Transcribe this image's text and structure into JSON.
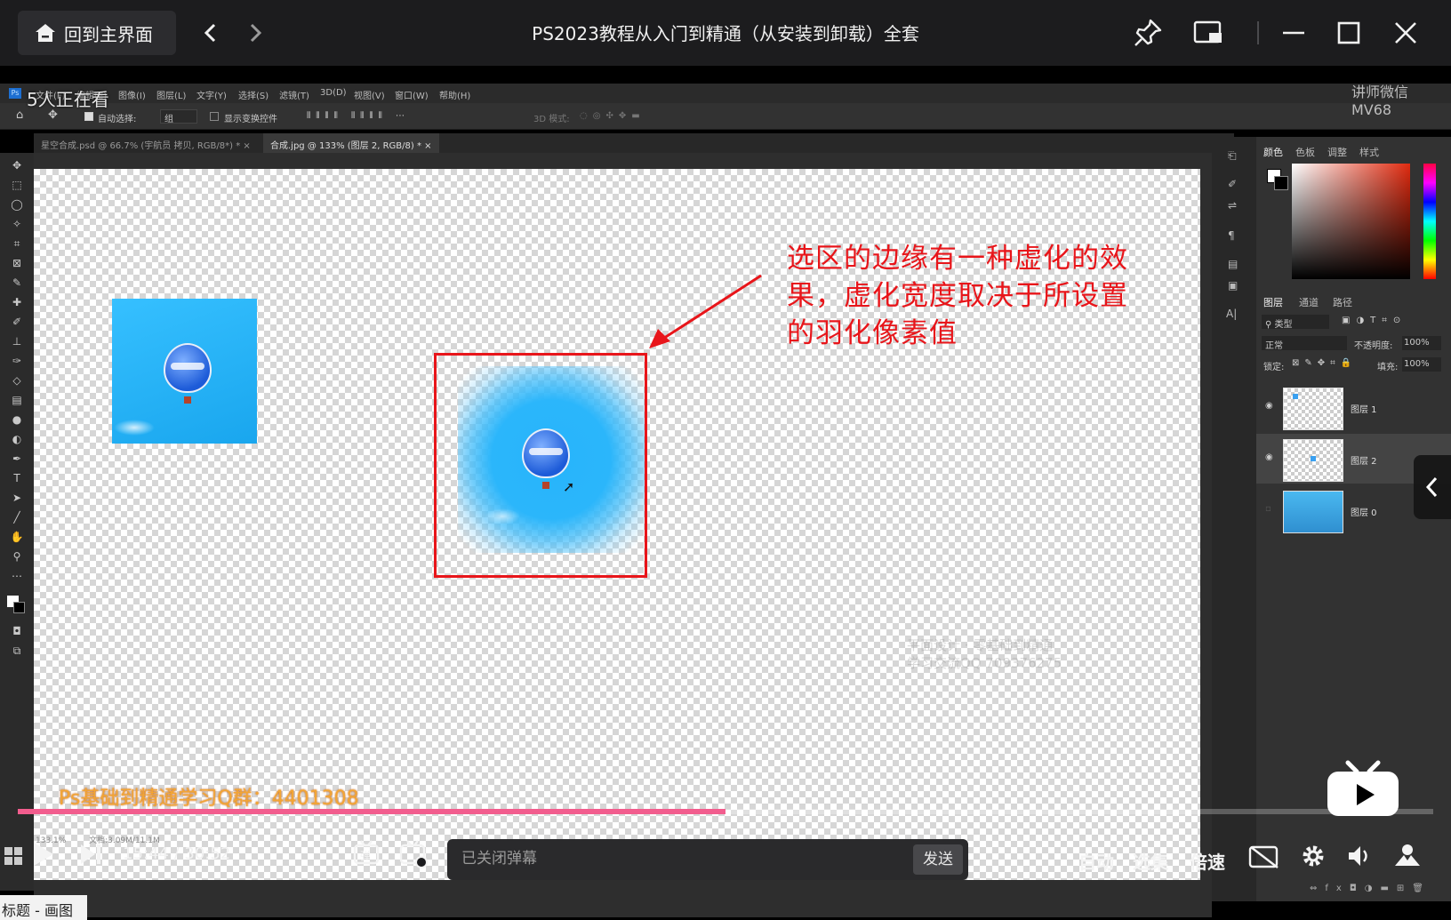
{
  "titlebar": {
    "home_label": "回到主界面",
    "title": "PS2023教程从入门到精通（从安装到卸载）全套"
  },
  "overlay": {
    "viewers": "5人正在看",
    "teacher_line1": "讲师微信",
    "teacher_line2": "MV68",
    "qq_group": "Ps基础到精通学习Q群：4401308",
    "watermark_line1": "平面设计 · 零基础到精通",
    "watermark_line2": "学习交流QQ 709376275"
  },
  "photoshop": {
    "menu": [
      "文件(F)",
      "编辑(E)",
      "图像(I)",
      "图层(L)",
      "文字(Y)",
      "选择(S)",
      "滤镜(T)",
      "3D(D)",
      "视图(V)",
      "窗口(W)",
      "帮助(H)"
    ],
    "options": {
      "auto_select": "自动选择:",
      "group": "组",
      "show_transform": "显示变换控件",
      "mode_3d": "3D 模式:"
    },
    "tabs": [
      "星空合成.psd @ 66.7% (宇航员 拷贝, RGB/8*) *",
      "合成.jpg @ 133% (图层 2, RGB/8) *"
    ],
    "panel_tabs_top": [
      "颜色",
      "色板",
      "调整",
      "样式"
    ],
    "panel_tabs_layers": [
      "图层",
      "通道",
      "路径"
    ],
    "layer_filter": "类型",
    "blend_mode": "正常",
    "opacity_label": "不透明度:",
    "opacity_value": "100%",
    "lock_label": "锁定:",
    "fill_label": "填充:",
    "fill_value": "100%",
    "layers": [
      "图层 1",
      "图层 2",
      "图层 0"
    ],
    "status_zoom": "133.1%",
    "status_doc": "文档:3.09M/11.1M"
  },
  "annotation": {
    "text": "选区的边缘有一种虚化的效果，虚化宽度取决于所设置的羽化像素值",
    "color": "#e8151a"
  },
  "player": {
    "progress": 0.5,
    "current_time": "15:44",
    "total_time": "30:52",
    "danmaku_placeholder": "已关闭弹幕",
    "send_label": "发送",
    "auto_label": "自动",
    "episodes_label": "选集",
    "speed_label": "倍速",
    "accent_color": "#f25d8e"
  },
  "taskbar": {
    "paint_title": "标题 - 画图"
  }
}
